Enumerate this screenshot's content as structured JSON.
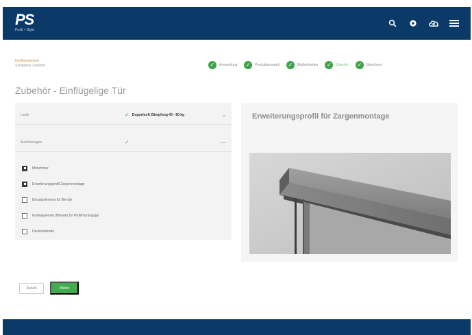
{
  "header": {
    "logo_mark": "PS",
    "logo_subtitle": "Profil + Style",
    "icons": [
      "search-icon",
      "settings-icon",
      "cloud-icon",
      "menu-icon"
    ],
    "background_color": "#0c3a68"
  },
  "breadcrumb": {
    "line1": "Konfigurationen",
    "line2": "Schiebetür Zubehör"
  },
  "steps": [
    {
      "label": "Anwendung",
      "state": "done"
    },
    {
      "label": "Produktauswahl",
      "state": "done"
    },
    {
      "label": "Maßeinheiten",
      "state": "done"
    },
    {
      "label": "Zubehör",
      "state": "active"
    },
    {
      "label": "Speichern",
      "state": "done"
    }
  ],
  "page_title": "Zubehör - Einflügelige Tür",
  "fields": [
    {
      "label": "Laufe",
      "value": "Doppelsoft Dämpfung 40 - 80 kg",
      "selected": true
    },
    {
      "label": "Ausführungen",
      "value": "",
      "selected": true
    }
  ],
  "options": [
    {
      "label": "Mitnehmer",
      "checked": true
    },
    {
      "label": "Erweiterungsprofil Zargenmontage",
      "checked": true
    },
    {
      "label": "Einsatzelement für Blende",
      "checked": false
    },
    {
      "label": "Endkappenset (Blende) für Profilmontagage",
      "checked": false
    },
    {
      "label": "Deckenblende",
      "checked": false
    }
  ],
  "preview": {
    "title": "Erweiterungsprofil für Zargenmontage",
    "image_alt": "Schiebetür-Profil Foto"
  },
  "buttons": {
    "back": "Zurück",
    "next": "Weiter"
  },
  "accent_color": "#42ad4e"
}
